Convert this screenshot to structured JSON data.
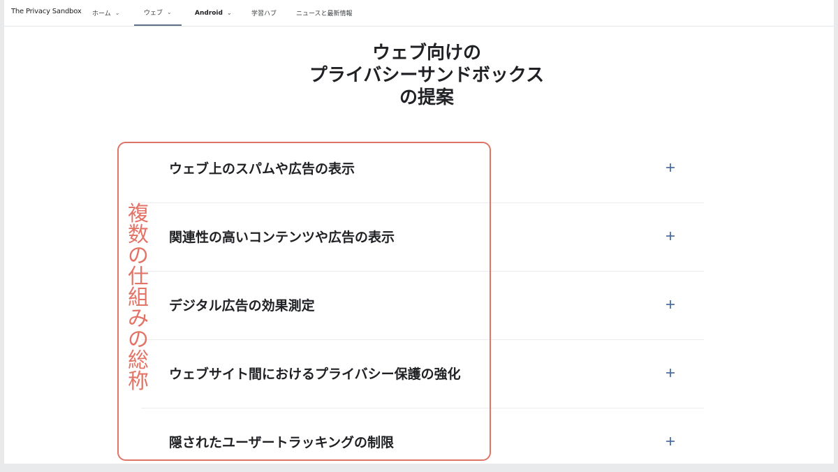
{
  "nav": {
    "brand": "The Privacy Sandbox",
    "items": [
      {
        "label": "ホーム"
      },
      {
        "label": "ウェブ"
      },
      {
        "label": "Android"
      },
      {
        "label": "学習ハブ"
      },
      {
        "label": "ニュースと最新情報"
      }
    ]
  },
  "heading": {
    "line1": "ウェブ向けの",
    "line2": "プライバシーサンドボックス",
    "line3": "の提案"
  },
  "accordion": [
    {
      "label": "ウェブ上のスパムや広告の表示"
    },
    {
      "label": "関連性の高いコンテンツや広告の表示"
    },
    {
      "label": "デジタル広告の効果測定"
    },
    {
      "label": "ウェブサイト間におけるプライバシー保護の強化"
    },
    {
      "label": "隠されたユーザートラッキングの制限"
    }
  ],
  "annotation": {
    "text": "複数の仕組みの総称",
    "chars": [
      "複",
      "数",
      "の",
      "仕",
      "組",
      "み",
      "の",
      "総",
      "称"
    ],
    "color": "#e37366"
  },
  "colors": {
    "accent": "#4a6fa5",
    "annotation_border": "#df7366"
  },
  "icons": {
    "expand": "plus-icon",
    "dropdown": "chevron-down-icon"
  }
}
